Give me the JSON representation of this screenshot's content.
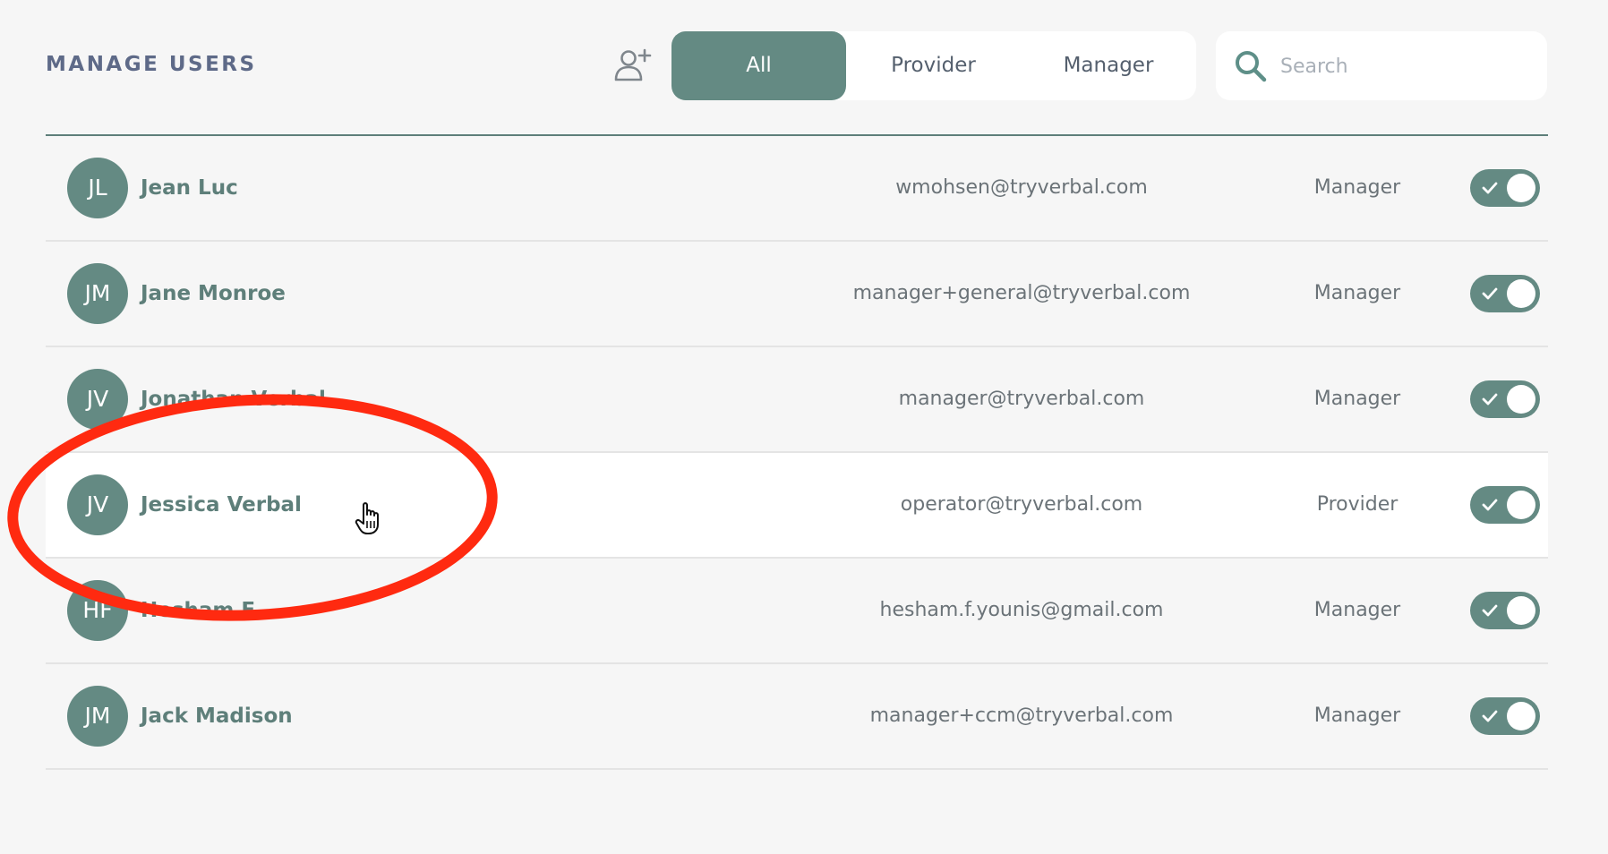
{
  "header": {
    "title": "MANAGE USERS"
  },
  "filters": {
    "tabs": [
      {
        "label": "All",
        "active": true
      },
      {
        "label": "Provider",
        "active": false
      },
      {
        "label": "Manager",
        "active": false
      }
    ]
  },
  "search": {
    "placeholder": "Search",
    "value": ""
  },
  "users": [
    {
      "initials": "JL",
      "name": "Jean Luc",
      "email": "wmohsen@tryverbal.com",
      "role": "Manager",
      "enabled": true
    },
    {
      "initials": "JM",
      "name": "Jane Monroe",
      "email": "manager+general@tryverbal.com",
      "role": "Manager",
      "enabled": true
    },
    {
      "initials": "JV",
      "name": "Jonathan Verbal",
      "email": "manager@tryverbal.com",
      "role": "Manager",
      "enabled": true
    },
    {
      "initials": "JV",
      "name": "Jessica Verbal",
      "email": "operator@tryverbal.com",
      "role": "Provider",
      "enabled": true
    },
    {
      "initials": "HF",
      "name": "Hesham F",
      "email": "hesham.f.younis@gmail.com",
      "role": "Manager",
      "enabled": true
    },
    {
      "initials": "JM",
      "name": "Jack Madison",
      "email": "manager+ccm@tryverbal.com",
      "role": "Manager",
      "enabled": true
    }
  ],
  "colors": {
    "accent": "#648a83",
    "title": "#5e6a88",
    "annotation": "#ff2a10"
  },
  "icons": {
    "add_user": "add-user-icon",
    "search": "search-icon",
    "toggle_check": "check-icon",
    "cursor": "hand-cursor-icon"
  }
}
